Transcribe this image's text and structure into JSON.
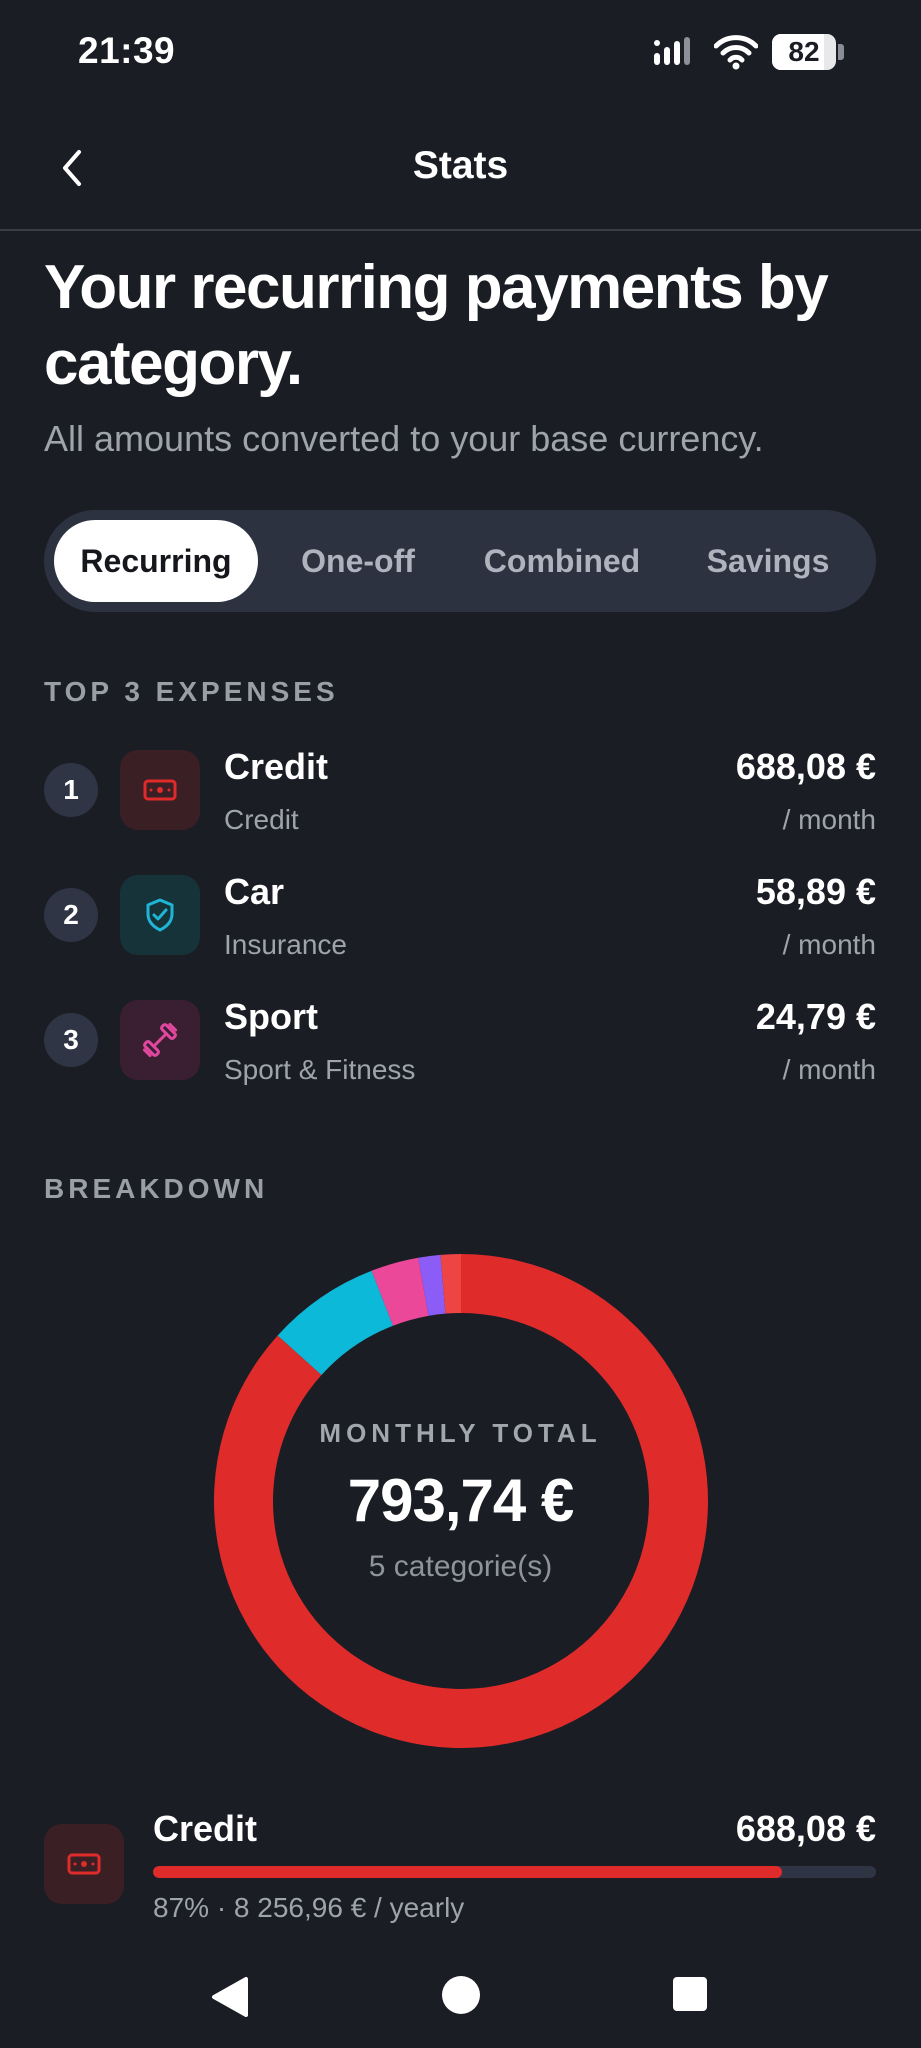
{
  "status_bar": {
    "time": "21:39",
    "battery": "82",
    "battery_level": 0.82
  },
  "header": {
    "title": "Stats"
  },
  "headline": "Your recurring payments by category.",
  "subtitle": "All amounts converted to your base currency.",
  "tabs": [
    {
      "label": "Recurring",
      "active": true
    },
    {
      "label": "One-off",
      "active": false
    },
    {
      "label": "Combined",
      "active": false
    },
    {
      "label": "Savings",
      "active": false
    }
  ],
  "top_expenses": {
    "title": "TOP 3 EXPENSES",
    "items": [
      {
        "rank": "1",
        "name": "Credit",
        "category": "Credit",
        "amount": "688,08 €",
        "period": "/ month",
        "icon": "banknote-icon",
        "color": "#e02b2b"
      },
      {
        "rank": "2",
        "name": "Car",
        "category": "Insurance",
        "amount": "58,89 €",
        "period": "/ month",
        "icon": "shield-check-icon",
        "color": "#1fb5d6"
      },
      {
        "rank": "3",
        "name": "Sport",
        "category": "Sport & Fitness",
        "amount": "24,79 €",
        "period": "/ month",
        "icon": "dumbbell-icon",
        "color": "#e0479e"
      }
    ]
  },
  "breakdown": {
    "title": "BREAKDOWN",
    "center_label": "MONTHLY TOTAL",
    "center_total": "793,74 €",
    "center_count": "5 categorie(s)",
    "item": {
      "name": "Credit",
      "amount": "688,08 €",
      "meta": "87% · 8 256,96 € / yearly",
      "share": 0.87,
      "icon": "banknote-icon"
    }
  },
  "chart_data": {
    "type": "pie",
    "slices": [
      {
        "label": "Credit",
        "value": 688.08,
        "color": "#e02b2b"
      },
      {
        "label": "Insurance",
        "value": 58.89,
        "color": "#0db9d8"
      },
      {
        "label": "Sport & Fitness",
        "value": 24.79,
        "color": "#ec4899"
      },
      {
        "value": 11.5,
        "color": "#8b5cf6"
      },
      {
        "value": 10.48,
        "color": "#ef4444"
      }
    ]
  },
  "colors": {
    "background": "#1b1d24",
    "accent_red": "#e02b2b",
    "tab_track": "#2d3240"
  }
}
